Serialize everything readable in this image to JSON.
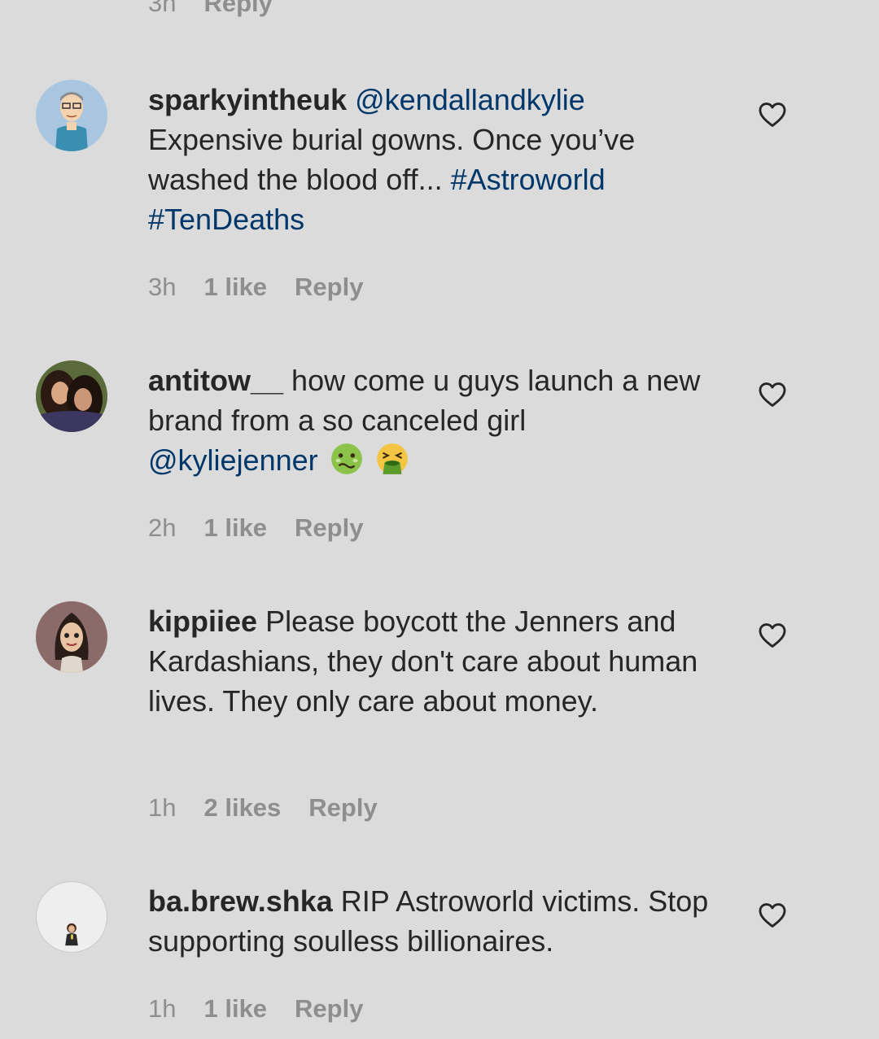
{
  "top_partial": {
    "time": "3h",
    "reply_label": "Reply"
  },
  "comments": [
    {
      "username": "sparkyintheuk",
      "mention": "@kendallandkylie",
      "body": "Expensive burial gowns. Once you’ve washed the blood off...",
      "hashtags": [
        "#Astroworld",
        "#TenDeaths"
      ],
      "time": "3h",
      "likes": "1 like",
      "reply_label": "Reply",
      "avatar_icon": "cartoon-man-avatar"
    },
    {
      "username": "antitow__",
      "body": "how come u guys launch a new brand from a so canceled girl",
      "mention": "@kyliejenner",
      "emojis": [
        "nauseated-face-icon",
        "vomiting-face-icon"
      ],
      "time": "2h",
      "likes": "1 like",
      "reply_label": "Reply",
      "avatar_icon": "two-girls-photo-avatar"
    },
    {
      "username": "kippiiee",
      "body": "Please boycott the Jenners and Kardashians, they don't care about human lives. They only care about money.",
      "time": "1h",
      "likes": "2 likes",
      "reply_label": "Reply",
      "avatar_icon": "cartoon-woman-avatar"
    },
    {
      "username": "ba.brew.shka",
      "body": "RIP Astroworld victims. Stop supporting soulless billionaires.",
      "time": "1h",
      "likes": "1 like",
      "reply_label": "Reply",
      "avatar_icon": "small-figure-avatar"
    }
  ],
  "colors": {
    "background": "#dbdbdb",
    "text": "#262626",
    "meta": "#8e8e8e",
    "link": "#00376b"
  }
}
